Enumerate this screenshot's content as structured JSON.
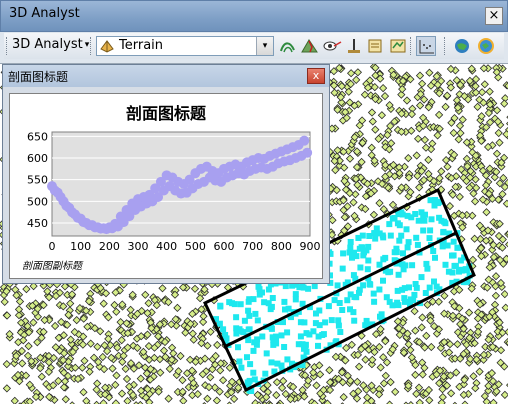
{
  "toolbar": {
    "title": "3D Analyst",
    "close_label": "×",
    "menu_label": "3D Analyst",
    "menu_arrow": "▾",
    "layer_value": "Terrain",
    "dropdown_arrow": "▾",
    "icons": [
      "contour-icon",
      "steepest-path-icon",
      "line-of-sight-icon",
      "interpolate-point-icon",
      "interpolate-line-icon",
      "interpolate-polygon-icon",
      "profile-graph-icon",
      "arcscene-icon",
      "arcglobe-icon"
    ]
  },
  "profile_window": {
    "title": "剖面图标题",
    "close_label": "x"
  },
  "colors": {
    "profile_points": "#a8a0f0",
    "selection_points": "#1ee8ee",
    "background_points": "#d6ee8a",
    "plot_bg": "#e0e0e0"
  },
  "chart_data": {
    "type": "scatter",
    "title": "剖面图标题",
    "subtitle": "剖面图副标题",
    "xlabel": "",
    "ylabel": "",
    "xlim": [
      0,
      900
    ],
    "ylim": [
      420,
      660
    ],
    "x_ticks": [
      0,
      100,
      200,
      300,
      400,
      500,
      600,
      700,
      800,
      900
    ],
    "y_ticks": [
      450,
      500,
      550,
      600,
      650
    ],
    "grid": true,
    "series": [
      {
        "x": [
          0,
          20,
          40,
          60,
          80,
          100,
          120,
          140,
          160,
          180,
          200,
          220,
          240,
          260,
          280,
          300,
          320,
          340,
          360,
          380,
          400,
          420,
          440,
          460,
          480,
          500,
          520,
          540,
          560,
          580,
          600,
          620,
          640,
          660,
          680,
          700,
          720,
          740,
          760,
          780,
          800,
          820,
          840,
          860,
          880
        ],
        "y": [
          535,
          520,
          500,
          485,
          470,
          460,
          450,
          445,
          440,
          438,
          440,
          448,
          465,
          480,
          495,
          505,
          510,
          515,
          530,
          545,
          560,
          555,
          545,
          540,
          550,
          565,
          575,
          580,
          570,
          565,
          575,
          580,
          585,
          580,
          590,
          595,
          600,
          598,
          605,
          610,
          615,
          620,
          625,
          630,
          640
        ]
      },
      {
        "x": [
          10,
          30,
          50,
          70,
          90,
          110,
          130,
          150,
          170,
          190,
          210,
          230,
          250,
          270,
          290,
          310,
          330,
          350,
          370,
          390,
          410,
          430,
          450,
          470,
          490,
          510,
          530,
          550,
          570,
          590,
          610,
          630,
          650,
          670,
          690,
          710,
          730,
          750,
          770,
          790,
          810,
          830,
          850,
          870,
          890
        ],
        "y": [
          525,
          510,
          490,
          475,
          462,
          452,
          445,
          440,
          437,
          436,
          438,
          442,
          452,
          466,
          480,
          488,
          495,
          500,
          510,
          525,
          535,
          525,
          518,
          520,
          530,
          540,
          545,
          555,
          548,
          545,
          555,
          560,
          565,
          562,
          570,
          575,
          578,
          575,
          580,
          588,
          592,
          595,
          600,
          605,
          612
        ]
      }
    ]
  }
}
